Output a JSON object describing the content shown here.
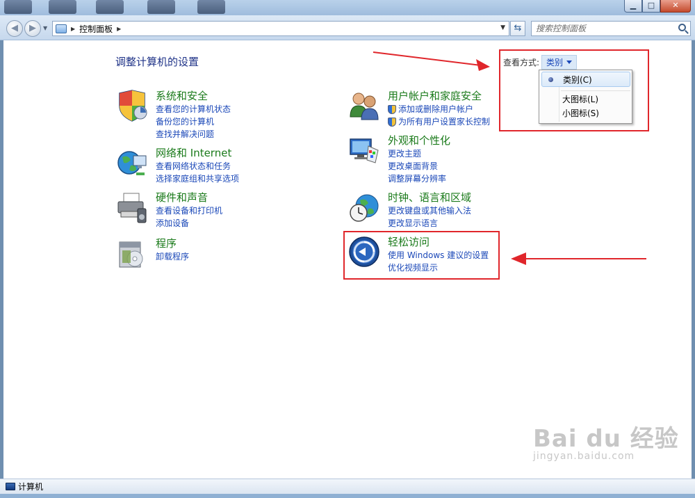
{
  "window": {
    "min_glyph": "▁",
    "max_glyph": "□",
    "close_glyph": "✕"
  },
  "addressbar": {
    "breadcrumb": "控制面板",
    "search_placeholder": "搜索控制面板"
  },
  "main": {
    "title": "调整计算机的设置",
    "view_by_label": "查看方式:",
    "view_by_value": "类别",
    "view_menu": [
      {
        "label": "类别(C)",
        "selected": true
      },
      {
        "label": "大图标(L)",
        "selected": false
      },
      {
        "label": "小图标(S)",
        "selected": false
      }
    ],
    "categories": [
      {
        "title": "系统和安全",
        "icon": "shield-icon",
        "links": [
          "查看您的计算机状态",
          "备份您的计算机",
          "查找并解决问题"
        ]
      },
      {
        "title": "网络和 Internet",
        "icon": "globe-icon",
        "links": [
          "查看网络状态和任务",
          "选择家庭组和共享选项"
        ]
      },
      {
        "title": "硬件和声音",
        "icon": "printer-icon",
        "links": [
          "查看设备和打印机",
          "添加设备"
        ]
      },
      {
        "title": "程序",
        "icon": "programs-icon",
        "links": [
          "卸载程序"
        ]
      },
      {
        "title": "用户帐户和家庭安全",
        "icon": "users-icon",
        "links": [
          "添加或删除用户帐户",
          "为所有用户设置家长控制"
        ]
      },
      {
        "title": "外观和个性化",
        "icon": "monitor-icon",
        "links": [
          "更改主题",
          "更改桌面背景",
          "调整屏幕分辨率"
        ]
      },
      {
        "title": "时钟、语言和区域",
        "icon": "clock-globe-icon",
        "links": [
          "更改键盘或其他输入法",
          "更改显示语言"
        ]
      },
      {
        "title": "轻松访问",
        "icon": "ease-of-access-icon",
        "links": [
          "使用 Windows 建议的设置",
          "优化视频显示"
        ]
      }
    ]
  },
  "statusbar": {
    "text": "计算机"
  },
  "watermark": {
    "logo": "Bai du 经验",
    "sub": "jingyan.baidu.com"
  },
  "colors": {
    "link": "#1b48b8",
    "category_title": "#1a7a1a",
    "annotation": "#e0262b"
  }
}
